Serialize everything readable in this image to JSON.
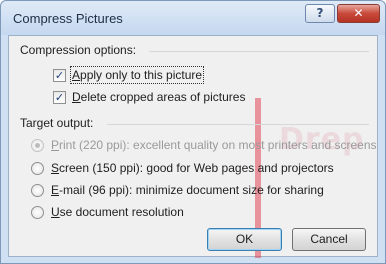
{
  "dialog": {
    "title": "Compress Pictures",
    "help_label": "?",
    "close_label": "✕"
  },
  "compression": {
    "label": "Compression options:",
    "apply_only": {
      "label": "Apply only to this picture",
      "checked": true
    },
    "delete_cropped": {
      "label": "Delete cropped areas of pictures",
      "checked": true
    }
  },
  "target": {
    "label": "Target output:",
    "options": [
      {
        "mnemonic": "P",
        "rest": "rint (220 ppi): excellent quality on most printers and screens",
        "selected": true,
        "disabled": true
      },
      {
        "mnemonic": "S",
        "rest": "creen (150 ppi): good for Web pages and projectors",
        "selected": false,
        "disabled": false
      },
      {
        "mnemonic": "E",
        "rest": "-mail (96 ppi): minimize document size for sharing",
        "selected": false,
        "disabled": false
      },
      {
        "mnemonic": "U",
        "rest": "se document resolution",
        "selected": false,
        "disabled": false
      }
    ]
  },
  "buttons": {
    "ok": "OK",
    "cancel": "Cancel"
  },
  "watermark": "Drep",
  "check_glyph": "✓"
}
